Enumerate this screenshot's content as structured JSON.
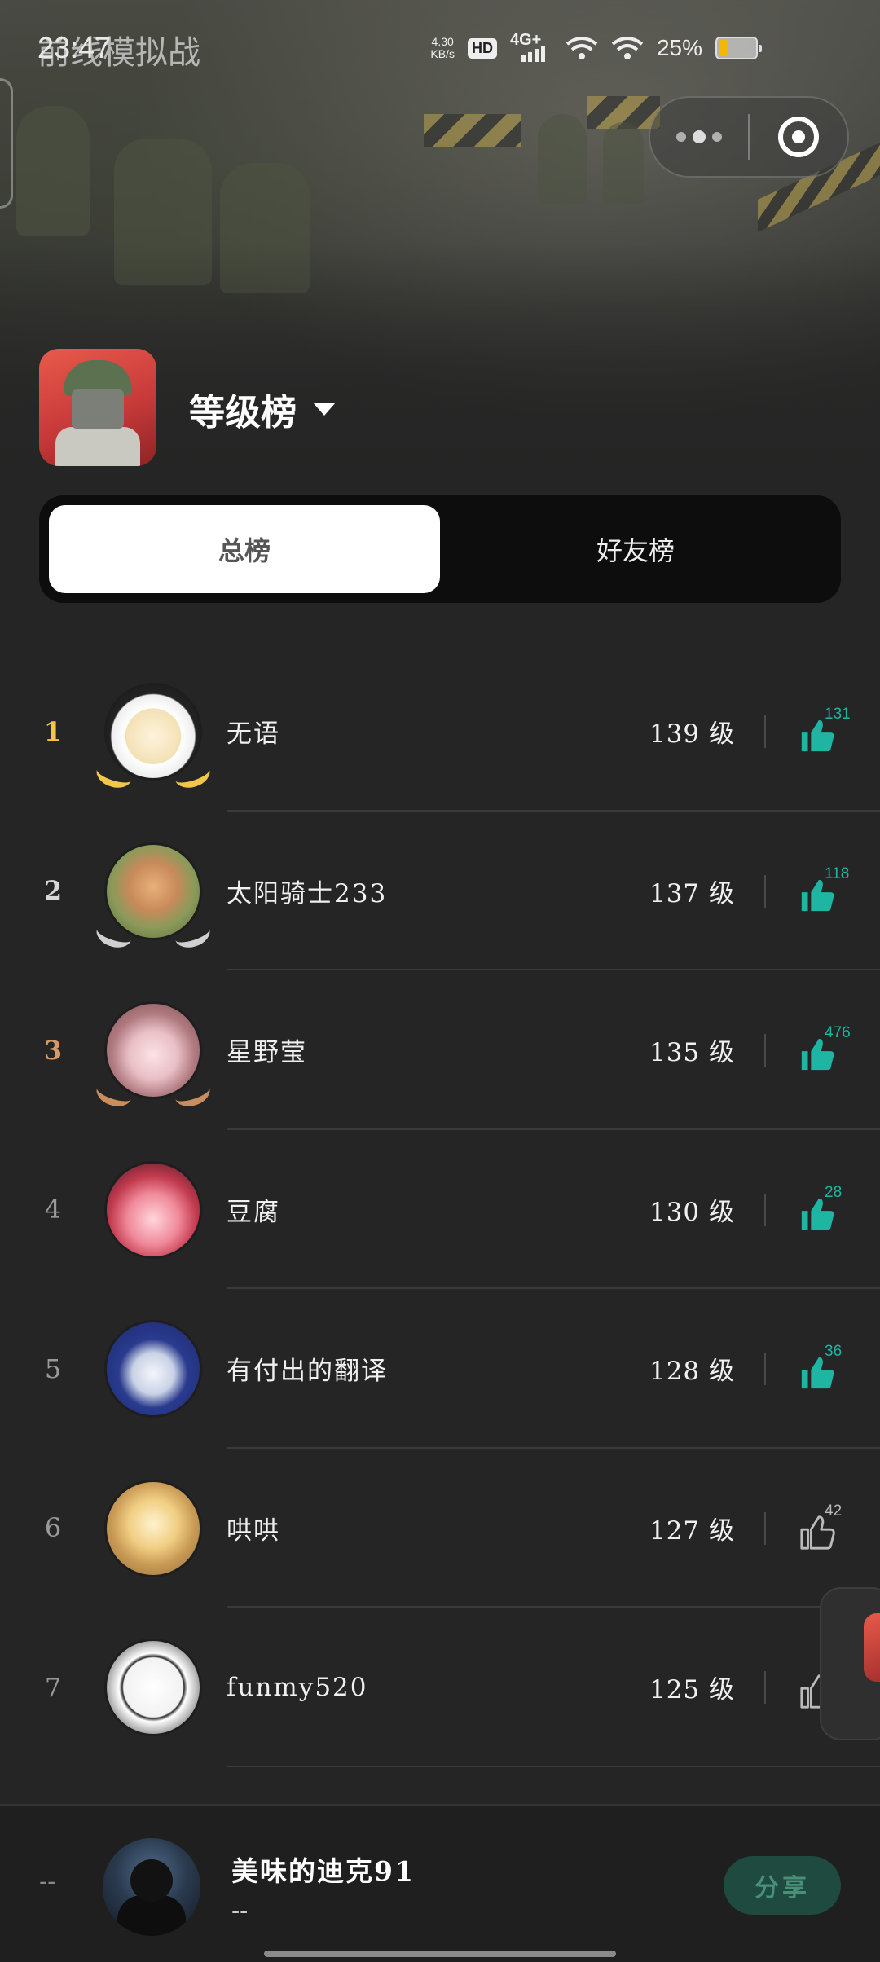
{
  "status_bar": {
    "time": "23:47",
    "app_overlay": "前线模拟战",
    "net_speed_value": "4.30",
    "net_speed_unit": "KB/s",
    "hd": "HD",
    "network": "4G+",
    "battery_pct": "25%",
    "battery_level": 0.25,
    "battery_color": "#f5b700"
  },
  "header": {
    "board_title": "等级榜",
    "game_icon": "game-soldier-icon"
  },
  "tabs": [
    {
      "label": "总榜",
      "active": true
    },
    {
      "label": "好友榜",
      "active": false
    }
  ],
  "rankings": [
    {
      "rank": "1",
      "name": "无语",
      "level": "139 级",
      "likes": "131",
      "liked": true
    },
    {
      "rank": "2",
      "name": "太阳骑士233",
      "level": "137 级",
      "likes": "118",
      "liked": true
    },
    {
      "rank": "3",
      "name": "星野莹",
      "level": "135 级",
      "likes": "476",
      "liked": true
    },
    {
      "rank": "4",
      "name": "豆腐",
      "level": "130 级",
      "likes": "28",
      "liked": true
    },
    {
      "rank": "5",
      "name": "有付出的翻译",
      "level": "128 级",
      "likes": "36",
      "liked": true
    },
    {
      "rank": "6",
      "name": "哄哄",
      "level": "127 级",
      "likes": "42",
      "liked": false
    },
    {
      "rank": "7",
      "name": "funmy520",
      "level": "125 级",
      "likes": "",
      "liked": false
    }
  ],
  "me": {
    "rank": "--",
    "name": "美味的迪克91",
    "level": "--",
    "share_label": "分享"
  },
  "colors": {
    "accent": "#1fb5a3",
    "gold": "#f3c64a",
    "silver": "#d8d8d8",
    "bronze": "#d49a6a",
    "background": "#252525"
  }
}
